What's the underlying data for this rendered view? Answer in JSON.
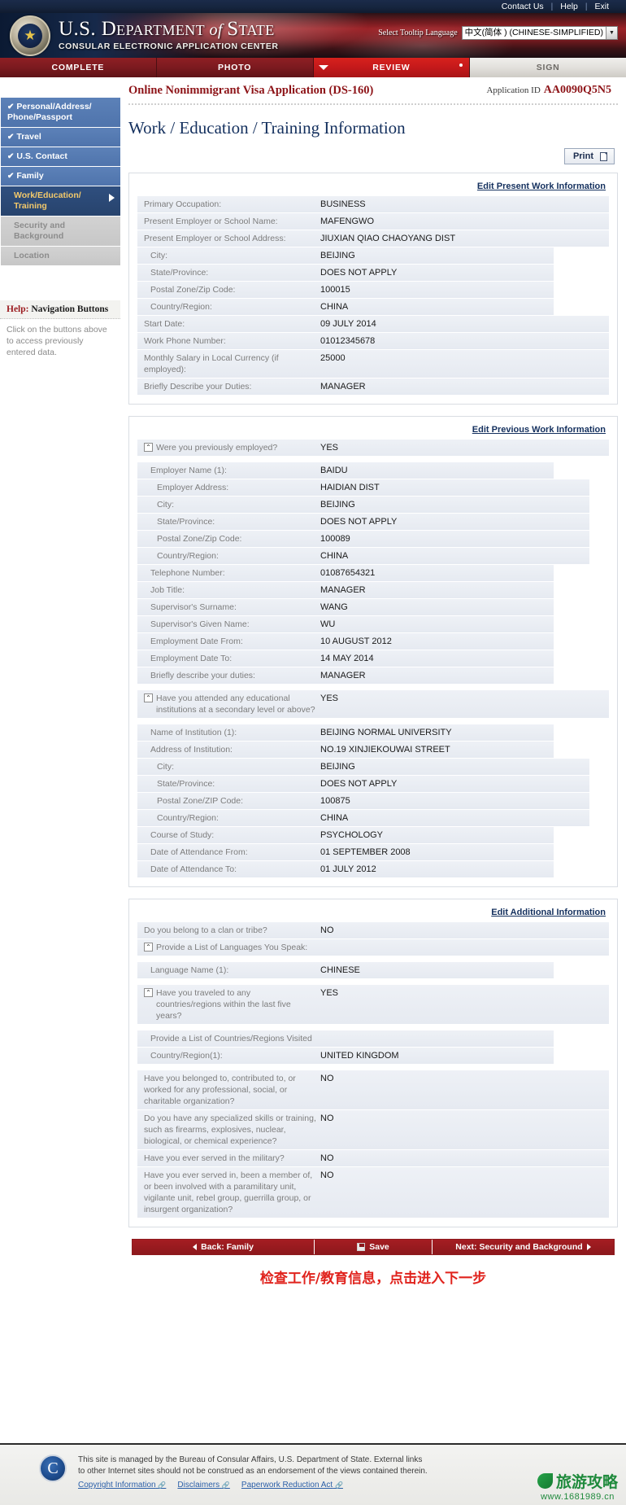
{
  "topbar": {
    "links": [
      "Contact Us",
      "Help",
      "Exit"
    ]
  },
  "banner": {
    "title_line1_a": "U.S. D",
    "title_line1_b": "EPARTMENT",
    "title_line1_of": " of ",
    "title_line1_c": "S",
    "title_line1_d": "TATE",
    "subtitle": "CONSULAR ELECTRONIC APPLICATION CENTER",
    "tooltip_label": "Select Tooltip Language",
    "tooltip_value": "中文(简体 ) (CHINESE-SIMPLIFIED)"
  },
  "steps": [
    {
      "label": "COMPLETE",
      "state": "done"
    },
    {
      "label": "PHOTO",
      "state": "done"
    },
    {
      "label": "REVIEW",
      "state": "active"
    },
    {
      "label": "SIGN",
      "state": "inactive"
    }
  ],
  "apphead": {
    "title": "Online Nonimmigrant Visa Application (DS-160)",
    "appid_label": "Application ID",
    "appid_value": "AA0090Q5N5"
  },
  "page_title": "Work / Education / Training Information",
  "sidebar": {
    "items": [
      {
        "label": "Personal/Address/ Phone/Passport",
        "state": "done",
        "check": "✔"
      },
      {
        "label": "Travel",
        "state": "done",
        "check": "✔"
      },
      {
        "label": "U.S. Contact",
        "state": "done",
        "check": "✔"
      },
      {
        "label": "Family",
        "state": "done",
        "check": "✔"
      },
      {
        "label": "Work/Education/ Training",
        "state": "current"
      },
      {
        "label": "Security and Background",
        "state": "disabled"
      },
      {
        "label": "Location",
        "state": "disabled"
      }
    ],
    "help": {
      "head_red": "Help:",
      "head_black": "Navigation Buttons",
      "text": "Click on the buttons above to access previously entered data."
    }
  },
  "print_button": "Print",
  "panels": [
    {
      "edit_link": "Edit Present Work Information",
      "rows": [
        {
          "label": "Primary Occupation:",
          "value": "BUSINESS",
          "indent": 0
        },
        {
          "label": "Present Employer or School Name:",
          "value": "MAFENGWO",
          "indent": 0
        },
        {
          "label": "Present Employer or School Address:",
          "value": "JIUXIAN QIAO CHAOYANG DIST",
          "indent": 0
        },
        {
          "label": "City:",
          "value": "BEIJING",
          "indent": 1
        },
        {
          "label": "State/Province:",
          "value": "DOES NOT APPLY",
          "indent": 1
        },
        {
          "label": "Postal Zone/Zip Code:",
          "value": "100015",
          "indent": 1
        },
        {
          "label": "Country/Region:",
          "value": "CHINA",
          "indent": 1
        },
        {
          "label": "Start Date:",
          "value": "09 JULY 2014",
          "indent": 0
        },
        {
          "label": "Work Phone Number:",
          "value": "01012345678",
          "indent": 0
        },
        {
          "label": "Monthly Salary in Local Currency (if employed):",
          "value": "25000",
          "indent": 0
        },
        {
          "label": "Briefly Describe your Duties:",
          "value": "MANAGER",
          "indent": 0
        }
      ]
    },
    {
      "edit_link": "Edit Previous Work Information",
      "rows": [
        {
          "label": "Were you previously employed?",
          "value": "YES",
          "indent": 0,
          "icon": true
        },
        {
          "label": "Employer Name (1):",
          "value": "BAIDU",
          "indent": 1,
          "gap_before": true
        },
        {
          "label": "Employer Address:",
          "value": "HAIDIAN DIST",
          "indent": 2
        },
        {
          "label": "City:",
          "value": "BEIJING",
          "indent": 2
        },
        {
          "label": "State/Province:",
          "value": "DOES NOT APPLY",
          "indent": 2
        },
        {
          "label": "Postal Zone/Zip Code:",
          "value": "100089",
          "indent": 2
        },
        {
          "label": "Country/Region:",
          "value": "CHINA",
          "indent": 2
        },
        {
          "label": "Telephone Number:",
          "value": "01087654321",
          "indent": 1
        },
        {
          "label": "Job Title:",
          "value": "MANAGER",
          "indent": 1
        },
        {
          "label": "Supervisor's Surname:",
          "value": "WANG",
          "indent": 1
        },
        {
          "label": "Supervisor's Given Name:",
          "value": "WU",
          "indent": 1
        },
        {
          "label": "Employment Date From:",
          "value": "10 AUGUST 2012",
          "indent": 1
        },
        {
          "label": "Employment Date To:",
          "value": "14 MAY 2014",
          "indent": 1
        },
        {
          "label": "Briefly describe your duties:",
          "value": "MANAGER",
          "indent": 1
        },
        {
          "label": "Have you attended any educational institutions at a secondary level or above?",
          "value": "YES",
          "indent": 0,
          "icon": true,
          "gap_before": true
        },
        {
          "label": "Name of Institution (1):",
          "value": "BEIJING NORMAL UNIVERSITY",
          "indent": 1,
          "gap_before": true
        },
        {
          "label": "Address of Institution:",
          "value": "NO.19 XINJIEKOUWAI STREET",
          "indent": 1
        },
        {
          "label": "City:",
          "value": "BEIJING",
          "indent": 2
        },
        {
          "label": "State/Province:",
          "value": "DOES NOT APPLY",
          "indent": 2
        },
        {
          "label": "Postal Zone/ZIP Code:",
          "value": "100875",
          "indent": 2
        },
        {
          "label": "Country/Region:",
          "value": "CHINA",
          "indent": 2
        },
        {
          "label": "Course of Study:",
          "value": "PSYCHOLOGY",
          "indent": 1
        },
        {
          "label": "Date of Attendance From:",
          "value": "01 SEPTEMBER 2008",
          "indent": 1
        },
        {
          "label": "Date of Attendance To:",
          "value": "01 JULY 2012",
          "indent": 1
        }
      ]
    },
    {
      "edit_link": "Edit Additional Information",
      "rows": [
        {
          "label": "Do you belong to a clan or tribe?",
          "value": "NO",
          "indent": 0
        },
        {
          "label": "Provide a List of Languages You Speak:",
          "value": "",
          "indent": 0,
          "icon": true
        },
        {
          "label": "Language Name (1):",
          "value": "CHINESE",
          "indent": 1,
          "gap_before": true
        },
        {
          "label": "Have you traveled to any countries/regions within the last five years?",
          "value": "YES",
          "indent": 0,
          "icon": true,
          "gap_before": true
        },
        {
          "label": "Provide a List of Countries/Regions Visited",
          "value": "",
          "indent": 1,
          "gap_before": true
        },
        {
          "label": "Country/Region(1):",
          "value": "UNITED KINGDOM",
          "indent": 1
        },
        {
          "label": "Have you belonged to, contributed to, or worked for any professional, social, or charitable organization?",
          "value": "NO",
          "indent": 0,
          "gap_before": true
        },
        {
          "label": "Do you have any specialized skills or training, such as firearms, explosives, nuclear, biological, or chemical experience?",
          "value": "NO",
          "indent": 0
        },
        {
          "label": "Have you ever served in the military?",
          "value": "NO",
          "indent": 0
        },
        {
          "label": "Have you ever served in, been a member of, or been involved with a paramilitary unit, vigilante unit, rebel group, guerrilla group, or insurgent organization?",
          "value": "NO",
          "indent": 0
        }
      ]
    }
  ],
  "actions": {
    "back": "Back: Family",
    "save": "Save",
    "next": "Next: Security and Background"
  },
  "annotation": "检查工作/教育信息，点击进入下一步",
  "footer": {
    "text": "This site is managed by the Bureau of Consular Affairs, U.S. Department of State. External links to other Internet sites should not be construed as an endorsement of the views contained therein.",
    "links": [
      "Copyright Information",
      "Disclaimers",
      "Paperwork Reduction Act"
    ]
  },
  "watermark": {
    "line1": "旅游攻略",
    "line2": "www.1681989.cn"
  }
}
